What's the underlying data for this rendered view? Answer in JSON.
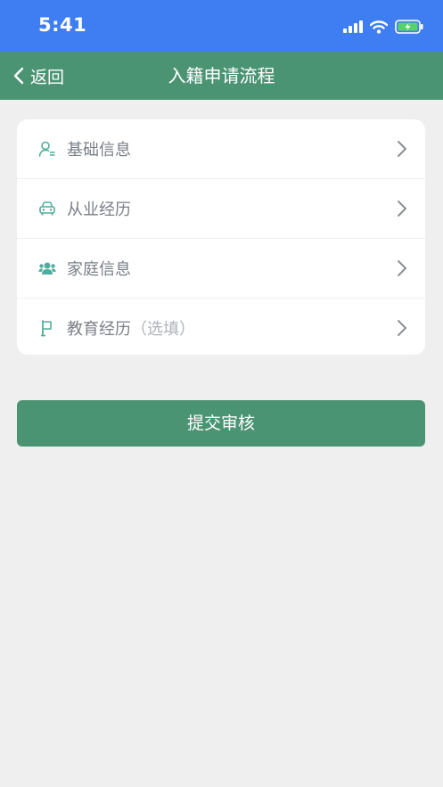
{
  "status": {
    "time": "5:41"
  },
  "nav": {
    "back_label": "返回",
    "title": "入籍申请流程"
  },
  "list": {
    "items": [
      {
        "label": "基础信息",
        "suffix": ""
      },
      {
        "label": "从业经历",
        "suffix": ""
      },
      {
        "label": "家庭信息",
        "suffix": ""
      },
      {
        "label": "教育经历",
        "suffix": "（选填）"
      }
    ]
  },
  "submit": {
    "label": "提交审核"
  },
  "colors": {
    "status_bar": "#3f7ef2",
    "accent": "#4b9473",
    "background": "#efefef",
    "icon": "#4fae9b"
  },
  "icons": [
    "person-list-icon",
    "car-icon",
    "family-icon",
    "flag-icon",
    "chevron-right-icon",
    "chevron-left-icon",
    "signal-icon",
    "wifi-icon",
    "battery-icon"
  ]
}
